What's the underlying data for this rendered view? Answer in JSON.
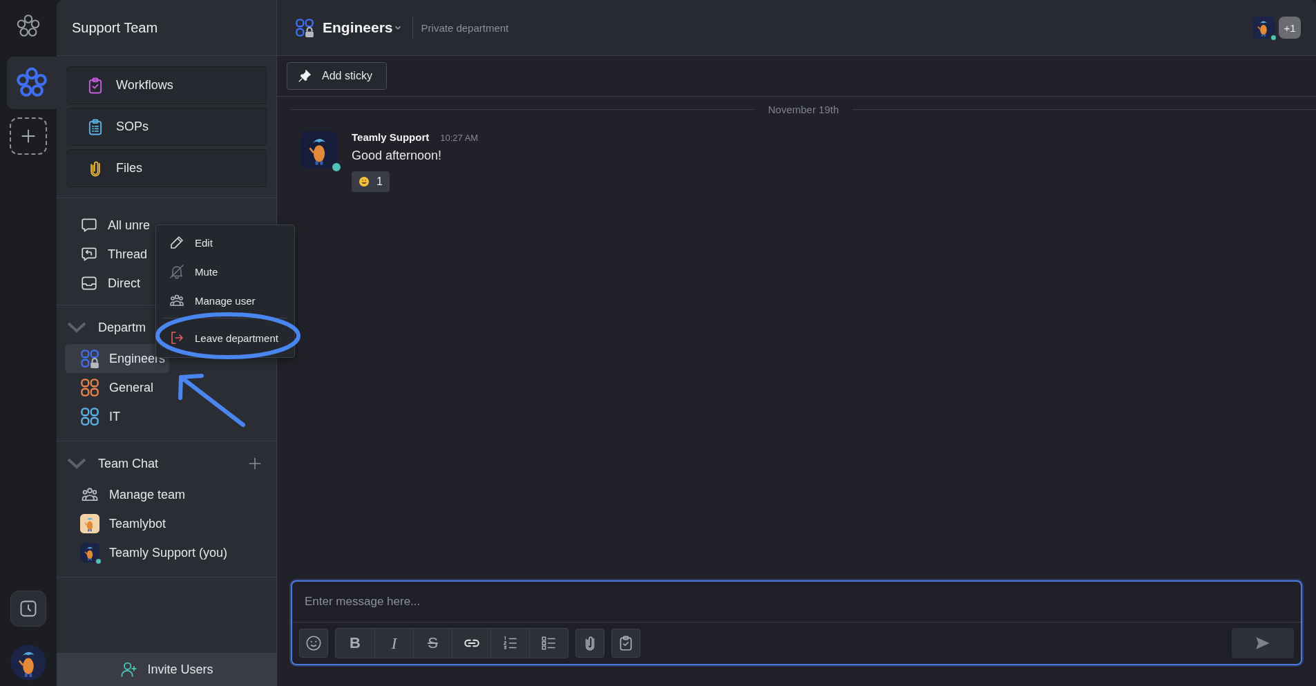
{
  "rail": {
    "teams": [
      {
        "selected": true
      }
    ]
  },
  "sidebar": {
    "title": "Support Team",
    "tools": [
      {
        "label": "Workflows",
        "kind": "workflows"
      },
      {
        "label": "SOPs",
        "kind": "sops"
      },
      {
        "label": "Files",
        "kind": "files"
      }
    ],
    "views": [
      {
        "label": "All unre",
        "kind": "unread"
      },
      {
        "label": "Thread",
        "kind": "threads"
      },
      {
        "label": "Direct",
        "kind": "direct"
      }
    ],
    "sections": [
      {
        "title": "Departm",
        "expanded": true,
        "addable": false,
        "items": [
          {
            "label": "Engineers",
            "kind": "department",
            "color": "#3f6ff0",
            "private": true,
            "selected": true
          },
          {
            "label": "General",
            "kind": "department",
            "color": "#e8834a",
            "private": false,
            "selected": false
          },
          {
            "label": "IT",
            "kind": "department",
            "color": "#5ab4e8",
            "private": false,
            "selected": false
          }
        ]
      },
      {
        "title": "Team Chat",
        "expanded": true,
        "addable": true,
        "items": [
          {
            "label": "Manage team",
            "kind": "manage",
            "selected": false
          },
          {
            "label": "Teamlybot",
            "kind": "bot",
            "selected": false
          },
          {
            "label": "Teamly Support (you)",
            "kind": "user",
            "online": true,
            "selected": false
          }
        ]
      }
    ],
    "invite": "Invite Users"
  },
  "header": {
    "title": "Engineers",
    "color": "#3f6ff0",
    "private": true,
    "subtitle": "Private department",
    "members": {
      "online": true,
      "extra": "+1"
    }
  },
  "toolbar": {
    "add_sticky": "Add sticky"
  },
  "chat": {
    "date": "November 19th",
    "messages": [
      {
        "author": "Teamly Support",
        "time": "10:27 AM",
        "text": "Good afternoon!",
        "online": true,
        "reactions": [
          {
            "count": "1"
          }
        ]
      }
    ]
  },
  "composer": {
    "placeholder": "Enter message here...",
    "format_buttons": [
      {
        "kind": "bold",
        "label": "B"
      },
      {
        "kind": "italic",
        "label": "I"
      },
      {
        "kind": "strike",
        "label": "S"
      },
      {
        "kind": "link"
      },
      {
        "kind": "ordered-list"
      },
      {
        "kind": "bullet-list"
      }
    ]
  },
  "context_menu": {
    "items": [
      {
        "label": "Edit",
        "kind": "edit"
      },
      {
        "label": "Mute",
        "kind": "mute"
      },
      {
        "label": "Manage user",
        "kind": "manage"
      },
      {
        "label": "Leave department",
        "kind": "leave"
      }
    ]
  }
}
